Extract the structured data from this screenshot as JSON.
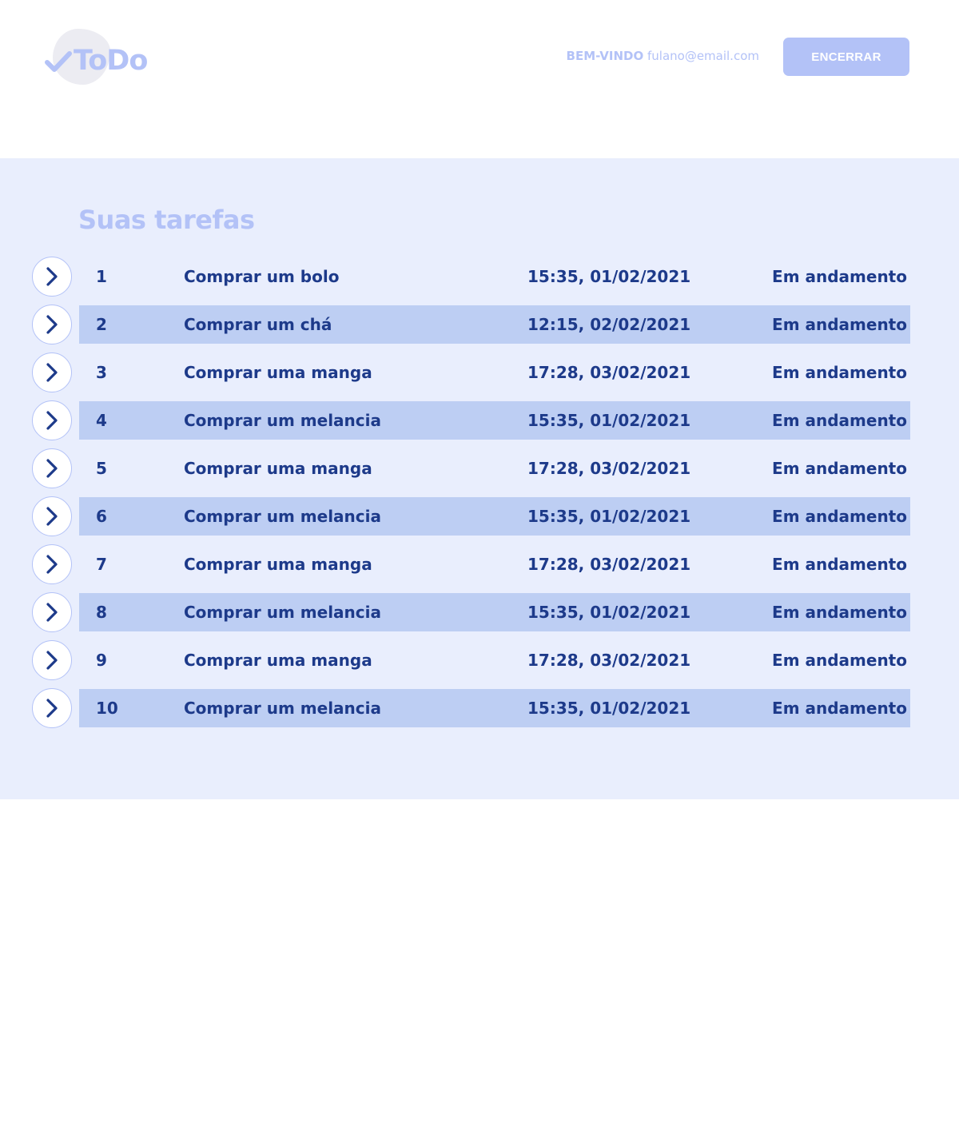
{
  "header": {
    "logo_text": "ToDo",
    "welcome_label": "BEM-VINDO",
    "user_email": "fulano@email.com",
    "end_button_label": "ENCERRAR"
  },
  "main": {
    "title": "Suas tarefas",
    "tasks": [
      {
        "id": "1",
        "name": "Comprar um bolo",
        "datetime": "15:35, 01/02/2021",
        "status": "Em andamento"
      },
      {
        "id": "2",
        "name": "Comprar um chá",
        "datetime": "12:15, 02/02/2021",
        "status": "Em andamento"
      },
      {
        "id": "3",
        "name": "Comprar uma manga",
        "datetime": "17:28, 03/02/2021",
        "status": "Em andamento"
      },
      {
        "id": "4",
        "name": "Comprar um melancia",
        "datetime": "15:35, 01/02/2021",
        "status": "Em andamento"
      },
      {
        "id": "5",
        "name": "Comprar uma manga",
        "datetime": "17:28, 03/02/2021",
        "status": "Em andamento"
      },
      {
        "id": "6",
        "name": "Comprar um melancia",
        "datetime": "15:35, 01/02/2021",
        "status": "Em andamento"
      },
      {
        "id": "7",
        "name": "Comprar uma manga",
        "datetime": "17:28, 03/02/2021",
        "status": "Em andamento"
      },
      {
        "id": "8",
        "name": "Comprar um melancia",
        "datetime": "15:35, 01/02/2021",
        "status": "Em andamento"
      },
      {
        "id": "9",
        "name": "Comprar uma manga",
        "datetime": "17:28, 03/02/2021",
        "status": "Em andamento"
      },
      {
        "id": "10",
        "name": "Comprar um melancia",
        "datetime": "15:35, 01/02/2021",
        "status": "Em andamento"
      }
    ]
  },
  "icons": {
    "logo_check": "check-icon",
    "row_expand": "chevron-right-icon"
  },
  "colors": {
    "accent_light": "#b3c2f7",
    "panel_bg": "#e9eefd",
    "row_alt_bg": "#bdcef3",
    "text_dark": "#1d3a8a"
  }
}
